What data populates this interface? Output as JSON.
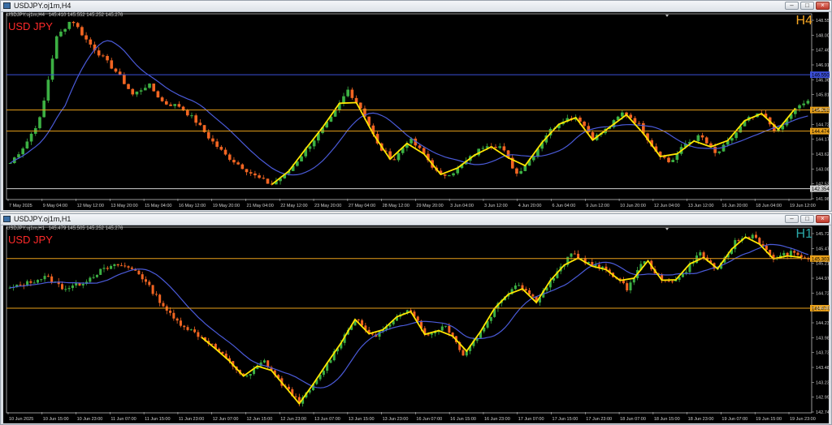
{
  "windows": [
    {
      "title": "USDJPY.oj1m,H4",
      "info_symbol": "USDJPY.oj1m,H4",
      "info_ohlc": "145.410 145.552 145.252 145.276",
      "symbol_label": "USD JPY",
      "timeframe_label": "H4",
      "timeframe_color": "#f5a623",
      "price_ticks": [
        "148.555",
        "148.005",
        "147.460",
        "146.910",
        "146.365",
        "145.815",
        "145.270",
        "144.725",
        "144.175",
        "143.620",
        "143.080",
        "142.535",
        "141.985"
      ],
      "levels": [
        {
          "label": "146.550",
          "color": "#3b4fd8"
        },
        {
          "label": "145.252",
          "color": "#e8a01a"
        },
        {
          "label": "144.474",
          "color": "#e8a01a"
        },
        {
          "label": "142.354",
          "color": "#d0d0d0"
        }
      ],
      "time_ticks": [
        "7 May 2025",
        "9 May 04:00",
        "12 May 12:00",
        "13 May 20:00",
        "15 May 04:00",
        "16 May 12:00",
        "19 May 20:00",
        "21 May 04:00",
        "22 May 12:00",
        "23 May 20:00",
        "27 May 04:00",
        "28 May 12:00",
        "29 May 20:00",
        "3 Jun 04:00",
        "3 Jun 12:00",
        "4 Jun 20:00",
        "6 Jun 04:00",
        "9 Jun 12:00",
        "10 Jun 20:00",
        "12 Jun 04:00",
        "13 Jun 12:00",
        "16 Jun 20:00",
        "18 Jun 04:00",
        "19 Jun 12:00"
      ]
    },
    {
      "title": "USDJPY.oj1m,H1",
      "info_symbol": "USDJPY.oj1m,H1",
      "info_ohlc": "145.479 145.505 145.252 145.276",
      "symbol_label": "USD JPY",
      "timeframe_label": "H1",
      "timeframe_color": "#2aa8a8",
      "price_ticks": [
        "145.720",
        "145.470",
        "145.215",
        "144.975",
        "144.725",
        "144.480",
        "144.230",
        "143.980",
        "143.730",
        "143.485",
        "143.235",
        "142.990",
        "142.740"
      ],
      "levels": [
        {
          "label": "145.303",
          "color": "#e8a01a"
        },
        {
          "label": "144.474",
          "color": "#e8a01a"
        }
      ],
      "time_ticks": [
        "10 Jun 2025",
        "10 Jun 15:00",
        "10 Jun 23:00",
        "11 Jun 07:00",
        "11 Jun 15:00",
        "11 Jun 23:00",
        "12 Jun 07:00",
        "12 Jun 15:00",
        "12 Jun 23:00",
        "13 Jun 07:00",
        "13 Jun 15:00",
        "13 Jun 23:00",
        "16 Jun 07:00",
        "16 Jun 15:00",
        "16 Jun 23:00",
        "17 Jun 07:00",
        "17 Jun 15:00",
        "17 Jun 23:00",
        "18 Jun 07:00",
        "18 Jun 15:00",
        "18 Jun 23:00",
        "19 Jun 07:00",
        "19 Jun 15:00",
        "19 Jun 23:00"
      ]
    }
  ],
  "chart_data": [
    {
      "type": "candlestick",
      "symbol": "USDJPY.oj1m",
      "timeframe": "H4",
      "x_range": [
        "7 May 2025",
        "19 Jun 12:00"
      ],
      "ylim": [
        141.985,
        148.555
      ],
      "close_path": [
        143.3,
        144.0,
        145.0,
        147.9,
        148.6,
        147.8,
        147.2,
        146.6,
        145.8,
        146.2,
        145.5,
        145.4,
        144.9,
        144.2,
        143.6,
        143.2,
        142.8,
        142.5,
        142.9,
        143.6,
        144.3,
        145.0,
        146.0,
        145.2,
        143.9,
        143.4,
        144.2,
        143.6,
        142.8,
        143.0,
        143.5,
        144.0,
        143.9,
        142.9,
        143.5,
        144.4,
        144.9,
        145.0,
        144.2,
        144.6,
        145.2,
        144.7,
        143.8,
        143.3,
        144.0,
        144.3,
        143.6,
        144.2,
        144.9,
        145.1,
        144.4,
        145.2,
        145.6
      ],
      "overlays": [
        {
          "name": "moving-average",
          "color": "#4a5ad8"
        },
        {
          "name": "zigzag",
          "color": "#ffe600"
        }
      ],
      "levels": [
        146.55,
        145.252,
        144.474,
        142.354
      ]
    },
    {
      "type": "candlestick",
      "symbol": "USDJPY.oj1m",
      "timeframe": "H1",
      "x_range": [
        "10 Jun 2025",
        "19 Jun 23:00"
      ],
      "ylim": [
        142.74,
        145.72
      ],
      "close_path": [
        144.8,
        144.9,
        145.0,
        144.8,
        144.9,
        145.1,
        145.2,
        145.1,
        144.7,
        144.3,
        144.1,
        143.9,
        143.6,
        143.3,
        143.6,
        143.2,
        142.9,
        143.3,
        143.8,
        144.3,
        144.0,
        144.2,
        144.5,
        144.0,
        144.2,
        143.7,
        144.1,
        144.6,
        144.9,
        144.6,
        145.0,
        145.4,
        145.2,
        145.1,
        144.8,
        145.3,
        144.9,
        145.0,
        145.4,
        145.1,
        145.6,
        145.7,
        145.3,
        145.4,
        145.3
      ],
      "overlays": [
        {
          "name": "moving-average",
          "color": "#4a5ad8"
        },
        {
          "name": "zigzag",
          "color": "#ffe600"
        }
      ],
      "levels": [
        145.303,
        144.474
      ]
    }
  ]
}
